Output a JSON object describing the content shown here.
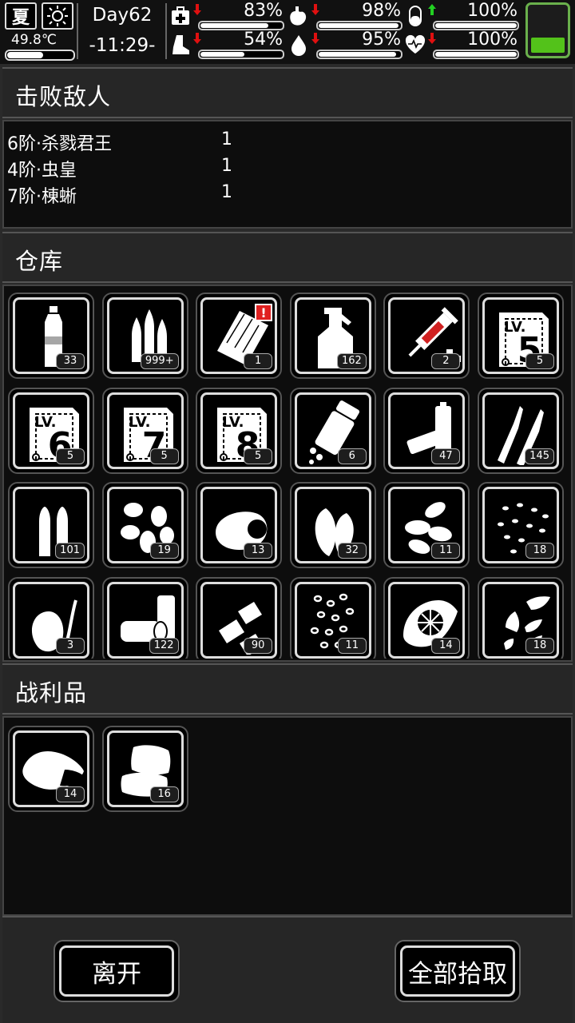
{
  "status": {
    "season": "夏",
    "temperature": "49.8℃",
    "temperature_level": 0.55,
    "day": "Day62",
    "time": "-11:29-",
    "stats": [
      {
        "icon": "medkit-icon",
        "value": "83%",
        "level": 0.83,
        "trend": "down"
      },
      {
        "icon": "stomach-icon",
        "value": "98%",
        "level": 0.98,
        "trend": "down"
      },
      {
        "icon": "pill-icon",
        "value": "100%",
        "level": 1.0,
        "trend": "up"
      },
      {
        "icon": "boot-icon",
        "value": "54%",
        "level": 0.54,
        "trend": "down"
      },
      {
        "icon": "water-drop-icon",
        "value": "95%",
        "level": 0.95,
        "trend": "down"
      },
      {
        "icon": "heart-icon",
        "value": "100%",
        "level": 1.0,
        "trend": "down"
      }
    ],
    "battery_level": 0.3,
    "colors": {
      "down_arrow": "#e01010",
      "up_arrow": "#22d022",
      "battery": "#53c21a"
    }
  },
  "defeated": {
    "title": "击败敌人",
    "enemies": [
      {
        "name": "6阶·杀戮君王",
        "count": "1"
      },
      {
        "name": "4阶·虫皇",
        "count": "1"
      },
      {
        "name": "7阶·棟蜥",
        "count": "1"
      }
    ]
  },
  "warehouse": {
    "title": "仓库",
    "items": [
      {
        "icon": "water-bottle-icon",
        "count": "33"
      },
      {
        "icon": "bullets-icon",
        "count": "999+"
      },
      {
        "icon": "clipboard-icon",
        "count": "1",
        "alert": "!"
      },
      {
        "icon": "spray-bottle-icon",
        "count": "162"
      },
      {
        "icon": "syringe-icon",
        "count": "2"
      },
      {
        "icon": "skill-book-icon",
        "count": "5",
        "level": "5"
      },
      {
        "icon": "skill-book-icon",
        "count": "5",
        "level": "6"
      },
      {
        "icon": "skill-book-icon",
        "count": "5",
        "level": "7"
      },
      {
        "icon": "skill-book-icon",
        "count": "5",
        "level": "8"
      },
      {
        "icon": "pill-bottle-icon",
        "count": "6"
      },
      {
        "icon": "batteries-icon",
        "count": "47"
      },
      {
        "icon": "rifle-rounds-icon",
        "count": "145"
      },
      {
        "icon": "pistol-rounds-icon",
        "count": "101"
      },
      {
        "icon": "nuts-icon",
        "count": "19"
      },
      {
        "icon": "raw-meat-icon",
        "count": "13"
      },
      {
        "icon": "leaves-icon",
        "count": "32"
      },
      {
        "icon": "almonds-icon",
        "count": "11"
      },
      {
        "icon": "seeds-icon",
        "count": "18"
      },
      {
        "icon": "onion-icon",
        "count": "3"
      },
      {
        "icon": "cans-icon",
        "count": "122"
      },
      {
        "icon": "shotgun-shells-icon",
        "count": "90"
      },
      {
        "icon": "grain-icon",
        "count": "11"
      },
      {
        "icon": "lemon-slice-icon",
        "count": "14"
      },
      {
        "icon": "sunflower-seeds-icon",
        "count": "18"
      }
    ]
  },
  "loot": {
    "title": "战利品",
    "items": [
      {
        "icon": "meat-chunk-icon",
        "count": "14"
      },
      {
        "icon": "cloth-icon",
        "count": "16"
      }
    ]
  },
  "buttons": {
    "leave": "离开",
    "take_all": "全部拾取"
  }
}
